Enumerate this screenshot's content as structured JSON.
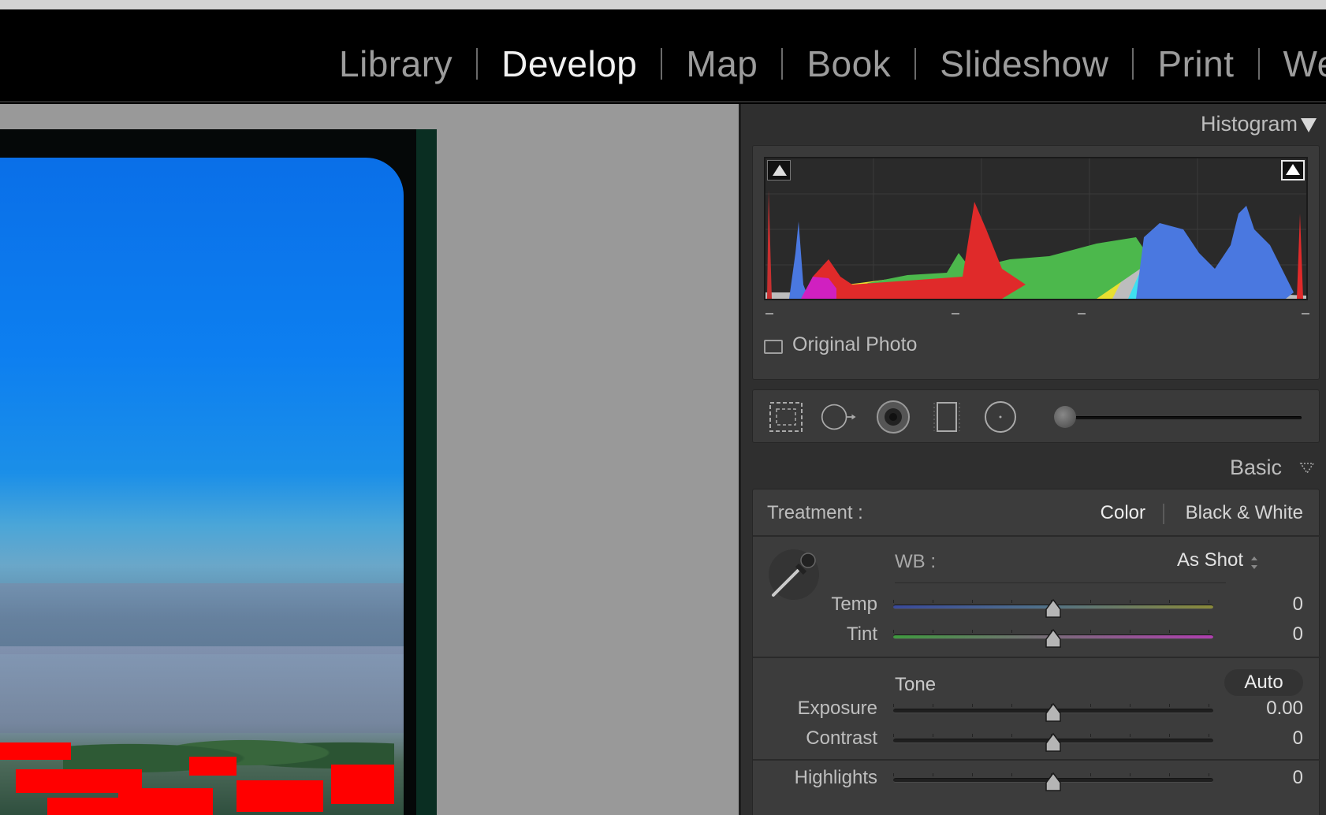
{
  "modules": [
    "Library",
    "Develop",
    "Map",
    "Book",
    "Slideshow",
    "Print",
    "We"
  ],
  "active_module": "Develop",
  "histogram": {
    "title": "Histogram",
    "original_photo_label": "Original Photo"
  },
  "basic": {
    "title": "Basic",
    "treatment_label": "Treatment :",
    "treatment_color": "Color",
    "treatment_bw": "Black & White",
    "wb_label": "WB :",
    "wb_value": "As Shot",
    "tone_label": "Tone",
    "auto_label": "Auto",
    "sliders": [
      {
        "name": "Temp",
        "value": "0",
        "position": 0.5
      },
      {
        "name": "Tint",
        "value": "0",
        "position": 0.5
      },
      {
        "name": "Exposure",
        "value": "0.00",
        "position": 0.5
      },
      {
        "name": "Contrast",
        "value": "0",
        "position": 0.5
      },
      {
        "name": "Highlights",
        "value": "0",
        "position": 0.5
      }
    ]
  },
  "colors": {
    "background": "#2f2f2f",
    "panel": "#3c3c3c",
    "text_active": "#f2f2f2",
    "text_inactive": "#9c9c9c",
    "clipping_highlight": "#ff0000"
  }
}
